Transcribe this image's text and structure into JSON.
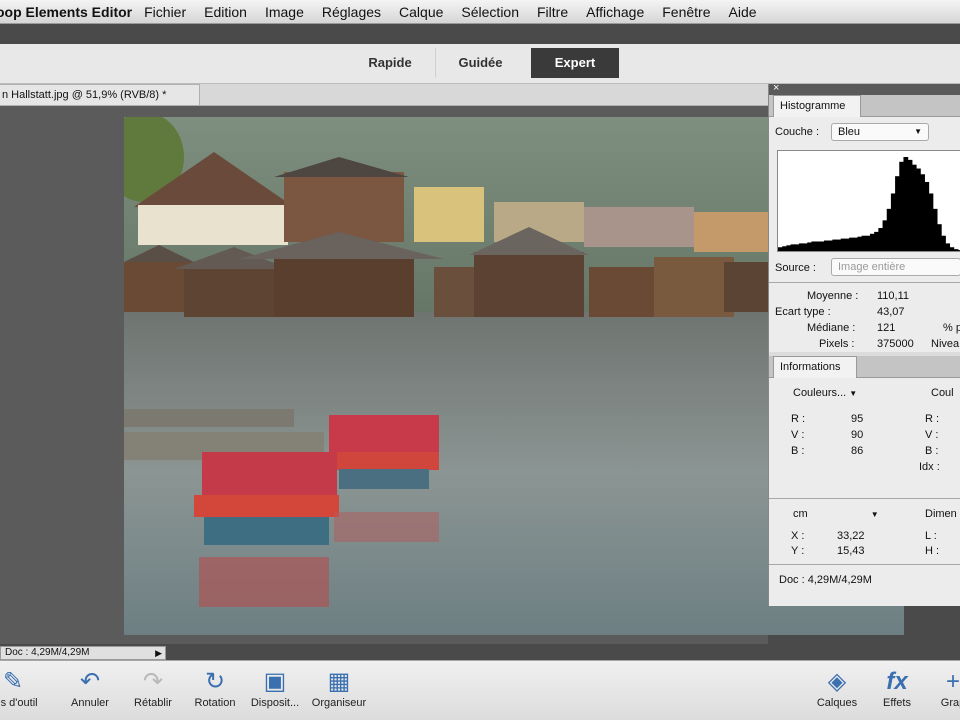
{
  "menubar": {
    "app": "oop Elements Editor",
    "items": [
      "Fichier",
      "Edition",
      "Image",
      "Réglages",
      "Calque",
      "Sélection",
      "Filtre",
      "Affichage",
      "Fenêtre",
      "Aide"
    ]
  },
  "modes": {
    "rapide": "Rapide",
    "guidee": "Guidée",
    "expert": "Expert"
  },
  "document": {
    "tab_title": "n Hallstatt.jpg @ 51,9% (RVB/8) *",
    "close": "×"
  },
  "panels": {
    "histogram": {
      "tab": "Histogramme",
      "channel_label": "Couche :",
      "channel_value": "Bleu",
      "source_label": "Source :",
      "source_value": "Image entière",
      "stats": {
        "moyenne_label": "Moyenne :",
        "moyenne": "110,11",
        "ecart_label": "Ecart type :",
        "ecart": "43,07",
        "mediane_label": "Médiane :",
        "mediane": "121",
        "pixels_label": "Pixels :",
        "pixels": "375000",
        "pct_label": "% p",
        "niveau_label": "Nivea"
      }
    },
    "info": {
      "tab": "Informations",
      "color_mode_1": "Couleurs...",
      "color_mode_2": "Coul",
      "rgb": {
        "r_label": "R :",
        "r": "95",
        "v_label": "V :",
        "v": "90",
        "b_label": "B :",
        "b": "86"
      },
      "rgb2": {
        "r_label": "R :",
        "v_label": "V :",
        "b_label": "B :",
        "idx_label": "Idx :"
      },
      "unit": "cm",
      "dim_label": "Dimen",
      "coords": {
        "x_label": "X :",
        "x": "33,22",
        "y_label": "Y :",
        "y": "15,43",
        "l_label": "L :",
        "h_label": "H :"
      },
      "doc": "Doc : 4,29M/4,29M"
    }
  },
  "status": {
    "doc": "Doc : 4,29M/4,29M"
  },
  "taskbar": {
    "outils": "ons d'outil",
    "annuler": "Annuler",
    "retablir": "Rétablir",
    "rotation": "Rotation",
    "disposition": "Disposit...",
    "organiseur": "Organiseur",
    "calques": "Calques",
    "effets": "Effets",
    "graph": "Grap"
  },
  "histogram_data": [
    0.06,
    0.07,
    0.08,
    0.09,
    0.09,
    0.1,
    0.1,
    0.11,
    0.12,
    0.12,
    0.12,
    0.13,
    0.13,
    0.14,
    0.14,
    0.15,
    0.15,
    0.16,
    0.16,
    0.17,
    0.18,
    0.18,
    0.2,
    0.22,
    0.26,
    0.34,
    0.46,
    0.62,
    0.8,
    0.95,
    1.0,
    0.97,
    0.92,
    0.88,
    0.82,
    0.74,
    0.62,
    0.46,
    0.3,
    0.18,
    0.1,
    0.06,
    0.04,
    0.03
  ],
  "colors": {
    "accent": "#3a6fb0",
    "mode_active": "#3a3a3a"
  }
}
